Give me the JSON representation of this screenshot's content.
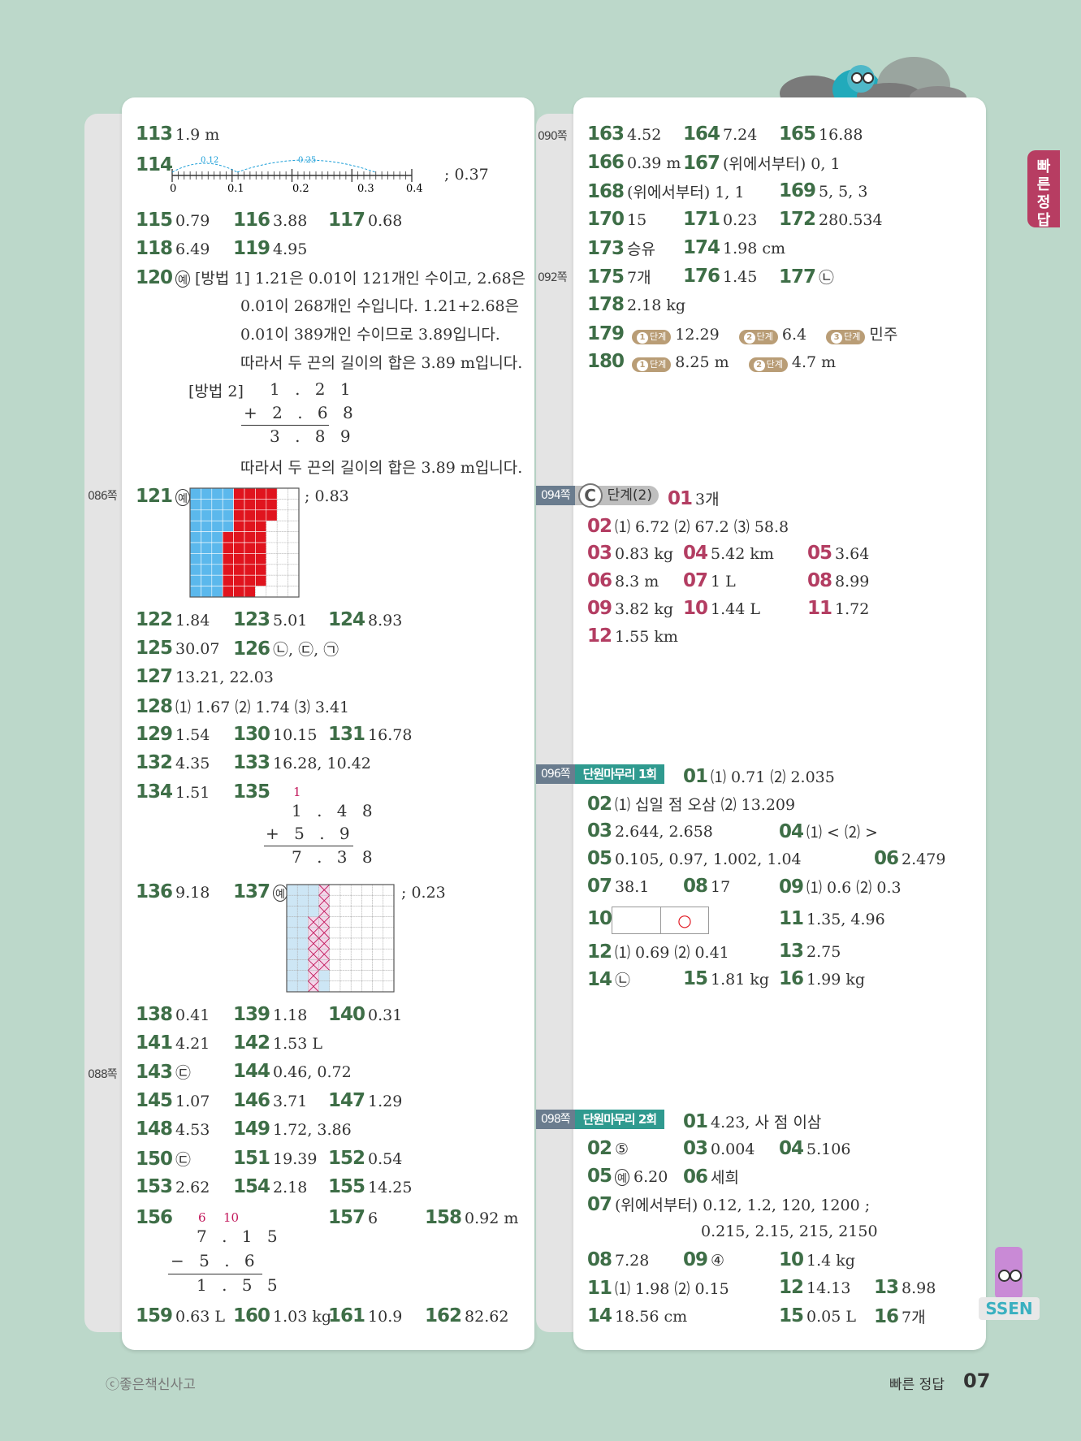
{
  "page": {
    "copyright": "ⓒ좋은책신사고",
    "section_label": "빠른 정답",
    "page_number": "07",
    "side_tab": "빠른정답",
    "brand_logo": "SSEN"
  },
  "page_refs": {
    "p086": "086쪽",
    "p088": "088쪽",
    "p090": "090쪽",
    "p092": "092쪽",
    "p094": "094쪽",
    "p096": "096쪽",
    "p098": "098쪽"
  },
  "section_tags": {
    "stage_c_letter": "C",
    "stage_c_label": "단계(2)",
    "review1": "단원마무리 1회",
    "review2": "단원마무리 2회"
  },
  "left": {
    "a113": {
      "n": "113",
      "v": "1.9 m"
    },
    "a114": {
      "n": "114",
      "v": "; 0.37",
      "ticks": [
        "0",
        "0.1",
        "0.2",
        "0.3",
        "0.4"
      ],
      "arc1": "0.12",
      "arc2": "0.25"
    },
    "a115": {
      "n": "115",
      "v": "0.79"
    },
    "a116": {
      "n": "116",
      "v": "3.88"
    },
    "a117": {
      "n": "117",
      "v": "0.68"
    },
    "a118": {
      "n": "118",
      "v": "6.49"
    },
    "a119": {
      "n": "119",
      "v": "4.95"
    },
    "a120": {
      "n": "120",
      "ex": "예",
      "lines": [
        "[방법 1] 1.21은 0.01이 121개인 수이고, 2.68은",
        "0.01이 268개인 수입니다. 1.21+2.68은",
        "0.01이 389개인 수이므로 3.89입니다.",
        "따라서 두 끈의 길이의 합은 3.89 m입니다.",
        "[방법 2]",
        "따라서 두 끈의 길이의 합은 3.89 m입니다."
      ],
      "calc": [
        "1 . 2 1",
        "+ 2 . 6 8",
        "3 . 8 9"
      ]
    },
    "a121": {
      "n": "121",
      "ex": "예",
      "v": "; 0.83"
    },
    "a122": {
      "n": "122",
      "v": "1.84"
    },
    "a123": {
      "n": "123",
      "v": "5.01"
    },
    "a124": {
      "n": "124",
      "v": "8.93"
    },
    "a125": {
      "n": "125",
      "v": "30.07"
    },
    "a126": {
      "n": "126",
      "v": "㉡, ㉢, ㉠"
    },
    "a127": {
      "n": "127",
      "v": "13.21, 22.03"
    },
    "a128": {
      "n": "128",
      "v": "⑴ 1.67 ⑵ 1.74 ⑶ 3.41"
    },
    "a129": {
      "n": "129",
      "v": "1.54"
    },
    "a130": {
      "n": "130",
      "v": "10.15"
    },
    "a131": {
      "n": "131",
      "v": "16.78"
    },
    "a132": {
      "n": "132",
      "v": "4.35"
    },
    "a133": {
      "n": "133",
      "v": "16.28, 10.42"
    },
    "a134": {
      "n": "134",
      "v": "1.51"
    },
    "a135": {
      "n": "135",
      "carry": "1",
      "calc": [
        "1 . 4 8",
        "+ 5 . 9",
        "7 . 3 8"
      ]
    },
    "a136": {
      "n": "136",
      "v": "9.18"
    },
    "a137": {
      "n": "137",
      "ex": "예",
      "v": "; 0.23"
    },
    "a138": {
      "n": "138",
      "v": "0.41"
    },
    "a139": {
      "n": "139",
      "v": "1.18"
    },
    "a140": {
      "n": "140",
      "v": "0.31"
    },
    "a141": {
      "n": "141",
      "v": "4.21"
    },
    "a142": {
      "n": "142",
      "v": "1.53 L"
    },
    "a143": {
      "n": "143",
      "v": "㉢"
    },
    "a144": {
      "n": "144",
      "v": "0.46, 0.72"
    },
    "a145": {
      "n": "145",
      "v": "1.07"
    },
    "a146": {
      "n": "146",
      "v": "3.71"
    },
    "a147": {
      "n": "147",
      "v": "1.29"
    },
    "a148": {
      "n": "148",
      "v": "4.53"
    },
    "a149": {
      "n": "149",
      "v": "1.72, 3.86"
    },
    "a150": {
      "n": "150",
      "v": "㉢"
    },
    "a151": {
      "n": "151",
      "v": "19.39"
    },
    "a152": {
      "n": "152",
      "v": "0.54"
    },
    "a153": {
      "n": "153",
      "v": "2.62"
    },
    "a154": {
      "n": "154",
      "v": "2.18"
    },
    "a155": {
      "n": "155",
      "v": "14.25"
    },
    "a156": {
      "n": "156",
      "carry1": "6",
      "carry2": "10",
      "calc": [
        "7 . 1 5",
        "− 5 . 6",
        "1 . 5 5"
      ]
    },
    "a157": {
      "n": "157",
      "v": "6"
    },
    "a158": {
      "n": "158",
      "v": "0.92 m"
    },
    "a159": {
      "n": "159",
      "v": "0.63 L"
    },
    "a160": {
      "n": "160",
      "v": "1.03 kg"
    },
    "a161": {
      "n": "161",
      "v": "10.9"
    },
    "a162": {
      "n": "162",
      "v": "82.62"
    }
  },
  "right": {
    "a163": {
      "n": "163",
      "v": "4.52"
    },
    "a164": {
      "n": "164",
      "v": "7.24"
    },
    "a165": {
      "n": "165",
      "v": "16.88"
    },
    "a166": {
      "n": "166",
      "v": "0.39 m"
    },
    "a167": {
      "n": "167",
      "v": "(위에서부터) 0, 1"
    },
    "a168": {
      "n": "168",
      "v": "(위에서부터) 1, 1"
    },
    "a169": {
      "n": "169",
      "v": "5, 5, 3"
    },
    "a170": {
      "n": "170",
      "v": "15"
    },
    "a171": {
      "n": "171",
      "v": "0.23"
    },
    "a172": {
      "n": "172",
      "v": "280.534"
    },
    "a173": {
      "n": "173",
      "v": "승유"
    },
    "a174": {
      "n": "174",
      "v": "1.98 cm"
    },
    "a175": {
      "n": "175",
      "v": "7개"
    },
    "a176": {
      "n": "176",
      "v": "1.45"
    },
    "a177": {
      "n": "177",
      "v": "㉡"
    },
    "a178": {
      "n": "178",
      "v": "2.18 kg"
    },
    "a179": {
      "n": "179",
      "s1": "12.29",
      "s2": "6.4",
      "s3": "민주"
    },
    "a180": {
      "n": "180",
      "s1": "8.25 m",
      "s2": "4.7 m"
    },
    "step_word": "단계",
    "c01": {
      "n": "01",
      "v": "3개"
    },
    "c02": {
      "n": "02",
      "v": "⑴ 6.72 ⑵ 67.2 ⑶ 58.8"
    },
    "c03": {
      "n": "03",
      "v": "0.83 kg"
    },
    "c04": {
      "n": "04",
      "v": "5.42 km"
    },
    "c05": {
      "n": "05",
      "v": "3.64"
    },
    "c06": {
      "n": "06",
      "v": "8.3 m"
    },
    "c07": {
      "n": "07",
      "v": "1 L"
    },
    "c08": {
      "n": "08",
      "v": "8.99"
    },
    "c09": {
      "n": "09",
      "v": "3.82 kg"
    },
    "c10": {
      "n": "10",
      "v": "1.44 L"
    },
    "c11": {
      "n": "11",
      "v": "1.72"
    },
    "c12": {
      "n": "12",
      "v": "1.55 km"
    },
    "r1_01": {
      "n": "01",
      "v": "⑴ 0.71 ⑵ 2.035"
    },
    "r1_02": {
      "n": "02",
      "v": "⑴ 십일 점 오삼 ⑵ 13.209"
    },
    "r1_03": {
      "n": "03",
      "v": "2.644, 2.658"
    },
    "r1_04": {
      "n": "04",
      "v": "⑴ < ⑵ >"
    },
    "r1_05": {
      "n": "05",
      "v": "0.105, 0.97, 1.002, 1.04"
    },
    "r1_06": {
      "n": "06",
      "v": "2.479"
    },
    "r1_07": {
      "n": "07",
      "v": "38.1"
    },
    "r1_08": {
      "n": "08",
      "v": "17"
    },
    "r1_09": {
      "n": "09",
      "v": "⑴ 0.6 ⑵ 0.3"
    },
    "r1_10": {
      "n": "10",
      "v": "○"
    },
    "r1_11": {
      "n": "11",
      "v": "1.35, 4.96"
    },
    "r1_12": {
      "n": "12",
      "v": "⑴ 0.69 ⑵ 0.41"
    },
    "r1_13": {
      "n": "13",
      "v": "2.75"
    },
    "r1_14": {
      "n": "14",
      "v": "㉡"
    },
    "r1_15": {
      "n": "15",
      "v": "1.81 kg"
    },
    "r1_16": {
      "n": "16",
      "v": "1.99 kg"
    },
    "r2_01": {
      "n": "01",
      "v": "4.23, 사 점 이삼"
    },
    "r2_02": {
      "n": "02",
      "v": "⑤"
    },
    "r2_03": {
      "n": "03",
      "v": "0.004"
    },
    "r2_04": {
      "n": "04",
      "v": "5.106"
    },
    "r2_05": {
      "n": "05",
      "ex": "예",
      "v": "6.20"
    },
    "r2_06": {
      "n": "06",
      "v": "세희"
    },
    "r2_07": {
      "n": "07",
      "v": "(위에서부터) 0.12, 1.2, 120, 1200 ;",
      "v2": "0.215, 2.15, 215, 2150"
    },
    "r2_08": {
      "n": "08",
      "v": "7.28"
    },
    "r2_09": {
      "n": "09",
      "v": "④"
    },
    "r2_10": {
      "n": "10",
      "v": "1.4 kg"
    },
    "r2_11": {
      "n": "11",
      "v": "⑴ 1.98 ⑵ 0.15"
    },
    "r2_12": {
      "n": "12",
      "v": "14.13"
    },
    "r2_13": {
      "n": "13",
      "v": "8.98"
    },
    "r2_14": {
      "n": "14",
      "v": "18.56 cm"
    },
    "r2_15": {
      "n": "15",
      "v": "0.05 L"
    },
    "r2_16": {
      "n": "16",
      "v": "7개"
    }
  },
  "colors": {
    "number_green": "#3e6e47",
    "number_pink": "#b33d62",
    "grid_blue": "#5bb8ec",
    "grid_red": "#e0141e",
    "background": "#bcd8ca"
  }
}
